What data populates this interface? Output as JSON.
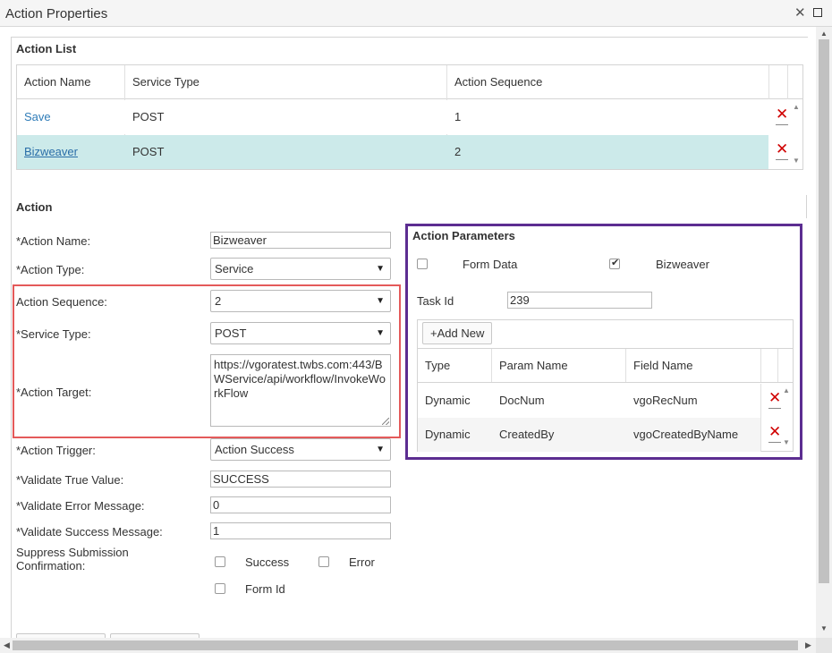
{
  "window": {
    "title": "Action Properties"
  },
  "action_list": {
    "title": "Action List",
    "columns": [
      "Action Name",
      "Service Type",
      "Action Sequence"
    ],
    "rows": [
      {
        "name": "Save",
        "service_type": "POST",
        "sequence": "1",
        "selected": false
      },
      {
        "name": "Bizweaver",
        "service_type": "POST",
        "sequence": "2",
        "selected": true
      }
    ]
  },
  "action": {
    "title": "Action",
    "name_label": "*Action Name:",
    "name_value": "Bizweaver",
    "type_label": "*Action Type:",
    "type_value": "Service",
    "sequence_label": "Action Sequence:",
    "sequence_value": "2",
    "service_type_label": "*Service Type:",
    "service_type_value": "POST",
    "target_label": "*Action Target:",
    "target_value": "https://vgoratest.twbs.com:443/BWService/api/workflow/InvokeWorkFlow",
    "trigger_label": "*Action Trigger:",
    "trigger_value": "Action Success",
    "validate_true_label": "*Validate True Value:",
    "validate_true_value": "SUCCESS",
    "validate_error_label": "*Validate Error Message:",
    "validate_error_value": "0",
    "validate_success_label": "*Validate Success Message:",
    "validate_success_value": "1",
    "suppress_label_1": "Suppress Submission",
    "suppress_label_2": "Confirmation:",
    "suppress_success_label": "Success",
    "suppress_error_label": "Error",
    "suppress_formid_label": "Form Id"
  },
  "parameters": {
    "title": "Action Parameters",
    "form_data_label": "Form Data",
    "form_data_checked": false,
    "bizweaver_label": "Bizweaver",
    "bizweaver_checked": true,
    "task_id_label": "Task Id",
    "task_id_value": "239",
    "add_new_label": "+Add New",
    "columns": [
      "Type",
      "Param Name",
      "Field Name"
    ],
    "rows": [
      {
        "type": "Dynamic",
        "param": "DocNum",
        "field": "vgoRecNum"
      },
      {
        "type": "Dynamic",
        "param": "CreatedBy",
        "field": "vgoCreatedByName"
      }
    ]
  },
  "icons": {
    "close": "close-icon",
    "maximize": "maximize-icon",
    "delete": "delete-x-icon",
    "dropdown": "chevron-down-icon"
  },
  "colors": {
    "selected_row": "#cceaea",
    "highlight_red": "#e45a5a",
    "highlight_purple": "#5c2d91",
    "link": "#2f7cb8",
    "delete_red": "#d00000"
  }
}
